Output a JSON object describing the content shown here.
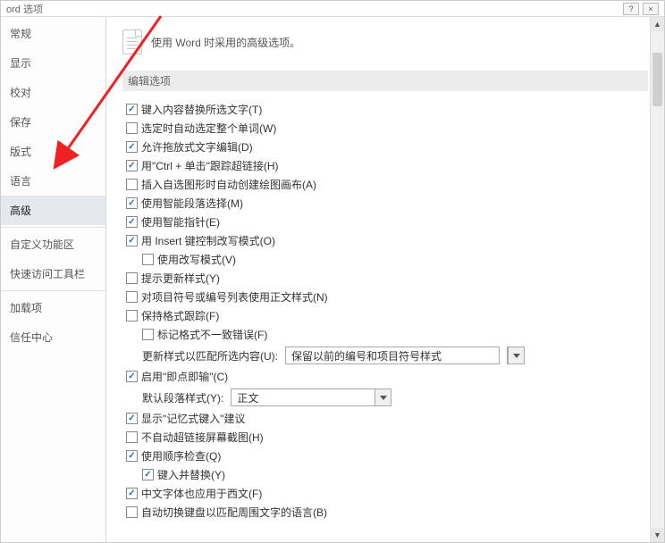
{
  "title": "ord 选项",
  "header_text": "使用 Word 时采用的高级选项。",
  "section_header": "编辑选项",
  "sidebar": {
    "items": [
      {
        "label": "常规"
      },
      {
        "label": "显示"
      },
      {
        "label": "校对"
      },
      {
        "label": "保存"
      },
      {
        "label": "版式"
      },
      {
        "label": "语言"
      },
      {
        "label": "高级"
      },
      {
        "label": "自定义功能区"
      },
      {
        "label": "快速访问工具栏"
      },
      {
        "label": "加载项"
      },
      {
        "label": "信任中心"
      }
    ],
    "selected_index": 6
  },
  "options": [
    {
      "checked": true,
      "indent": 1,
      "label": "键入内容替换所选文字(T)"
    },
    {
      "checked": false,
      "indent": 1,
      "label": "选定时自动选定整个单词(W)"
    },
    {
      "checked": true,
      "indent": 1,
      "label": "允许拖放式文字编辑(D)"
    },
    {
      "checked": true,
      "indent": 1,
      "label": "用\"Ctrl + 单击\"跟踪超链接(H)"
    },
    {
      "checked": false,
      "indent": 1,
      "label": "插入自选图形时自动创建绘图画布(A)"
    },
    {
      "checked": true,
      "indent": 1,
      "label": "使用智能段落选择(M)"
    },
    {
      "checked": true,
      "indent": 1,
      "label": "使用智能指针(E)"
    },
    {
      "checked": true,
      "indent": 1,
      "label": "用 Insert 键控制改写模式(O)"
    },
    {
      "checked": false,
      "indent": 2,
      "label": "使用改写模式(V)"
    },
    {
      "checked": false,
      "indent": 1,
      "label": "提示更新样式(Y)"
    },
    {
      "checked": false,
      "indent": 1,
      "label": "对项目符号或编号列表使用正文样式(N)"
    },
    {
      "checked": false,
      "indent": 1,
      "label": "保持格式跟踪(F)"
    },
    {
      "checked": false,
      "indent": 2,
      "label": "标记格式不一致错误(F)"
    }
  ],
  "fields": {
    "update_style": {
      "label": "更新样式以匹配所选内容(U):",
      "value": "保留以前的编号和项目符号样式"
    },
    "default_para": {
      "label": "默认段落样式(Y):",
      "value": "正文"
    }
  },
  "options2": [
    {
      "checked": true,
      "indent": 1,
      "label": "启用\"即点即输\"(C)"
    }
  ],
  "options3": [
    {
      "checked": true,
      "indent": 1,
      "label": "显示\"记忆式键入\"建议"
    },
    {
      "checked": false,
      "indent": 1,
      "label": "不自动超链接屏幕截图(H)"
    },
    {
      "checked": true,
      "indent": 1,
      "label": "使用顺序检查(Q)"
    },
    {
      "checked": true,
      "indent": 2,
      "label": "键入并替换(Y)"
    },
    {
      "checked": true,
      "indent": 1,
      "label": "中文字体也应用于西文(F)"
    },
    {
      "checked": false,
      "indent": 1,
      "label": "自动切换键盘以匹配周围文字的语言(B)"
    }
  ]
}
